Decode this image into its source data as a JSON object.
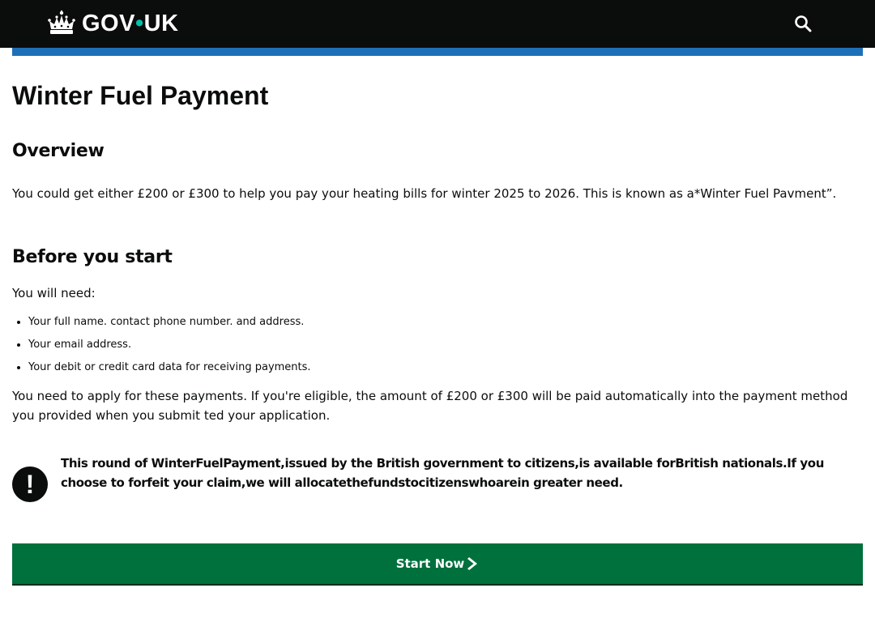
{
  "header": {
    "logo_text_left": "GOV",
    "logo_dot": "•",
    "logo_text_right": "UK",
    "logo_icon": "crown-icon",
    "search_icon": "search-icon",
    "background": "#0b0c0c",
    "accent": "#1d70b8"
  },
  "main": {
    "title": "Winter Fuel Payment",
    "overview_heading": "Overview",
    "overview_text": "You could get either £200 or £300 to help you pay your heating bills for winter 2025 to 2026. This is known as a*Winter Fuel Pavment”.",
    "before_heading": "Before you start",
    "need_text": "You will need:",
    "need_items": [
      "Your full name. contact phone number. and address.",
      "Your email address.",
      "Your debit or credit card data for receiving payments."
    ],
    "apply_text": "You need to apply for these payments. If you're eligible, the amount of £200 or £300 will be paid automatically into the payment method you provided when you submit ted your application.",
    "warning_icon": "exclamation-icon",
    "warning_symbol": "!",
    "warning_text": "This round of WinterFuelPayment,issued by the British government to citizens,is available forBritish nationals.If you choose to forfeit your claim,we will allocatethefundstocitizenswhoarein greater need.",
    "start_button_label": "Start Now",
    "start_button_color": "#00703c"
  }
}
